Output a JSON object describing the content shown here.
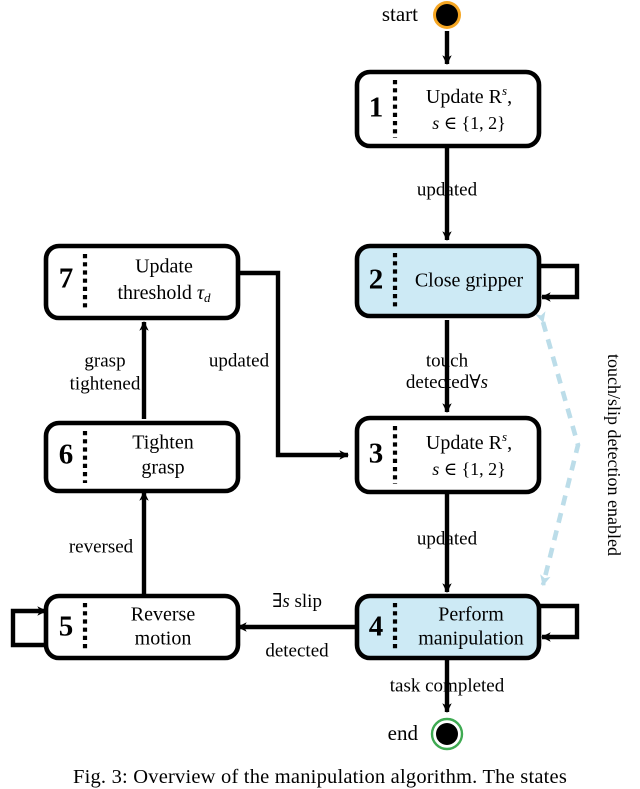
{
  "figure": {
    "caption": "Fig. 3: Overview of the manipulation algorithm. The states"
  },
  "terminals": {
    "start_label": "start",
    "end_label": "end",
    "start_ring_color": "#f5a623",
    "end_ring_color": "#3faa52",
    "node_fill": "#000000"
  },
  "colors": {
    "highlight_fill": "#cdeaf5",
    "dashed_link": "#bcdde9",
    "stroke": "#000000"
  },
  "states": [
    {
      "num": "1",
      "line1": "Update R",
      "line1_sup": "s",
      "line1_tail": ",",
      "line2_a": "s",
      "line2_b": " ∈ {1, 2}",
      "highlighted": false
    },
    {
      "num": "2",
      "line1": "Close gripper",
      "line2": "",
      "highlighted": true
    },
    {
      "num": "3",
      "line1": "Update R",
      "line1_sup": "s",
      "line1_tail": ",",
      "line2_a": "s",
      "line2_b": " ∈ {1, 2}",
      "highlighted": false
    },
    {
      "num": "4",
      "line1": "Perform",
      "line2": "manipulation",
      "highlighted": true
    },
    {
      "num": "5",
      "line1": "Reverse",
      "line2": "motion",
      "highlighted": false
    },
    {
      "num": "6",
      "line1": "Tighten",
      "line2": "grasp",
      "highlighted": false
    },
    {
      "num": "7",
      "line1": "Update",
      "line2_a": "threshold ",
      "line2_b": "τ",
      "line2_sub": "d",
      "highlighted": false
    }
  ],
  "edges": {
    "one_to_two": "updated",
    "two_to_three_l1": "touch",
    "two_to_three_l2_a": "detected",
    "two_to_three_l2_b": "∀",
    "two_to_three_l2_c": "s",
    "three_to_four": "updated",
    "four_to_end": "task completed",
    "four_to_five_l1_a": "∃",
    "four_to_five_l1_b": "s",
    "four_to_five_l1_c": " slip",
    "four_to_five_l2": "detected",
    "five_to_six": "reversed",
    "six_to_seven_l1": "grasp",
    "six_to_seven_l2": "tightened",
    "seven_to_three": "updated",
    "dashed_annotation": "touch/slip detection enabled"
  }
}
